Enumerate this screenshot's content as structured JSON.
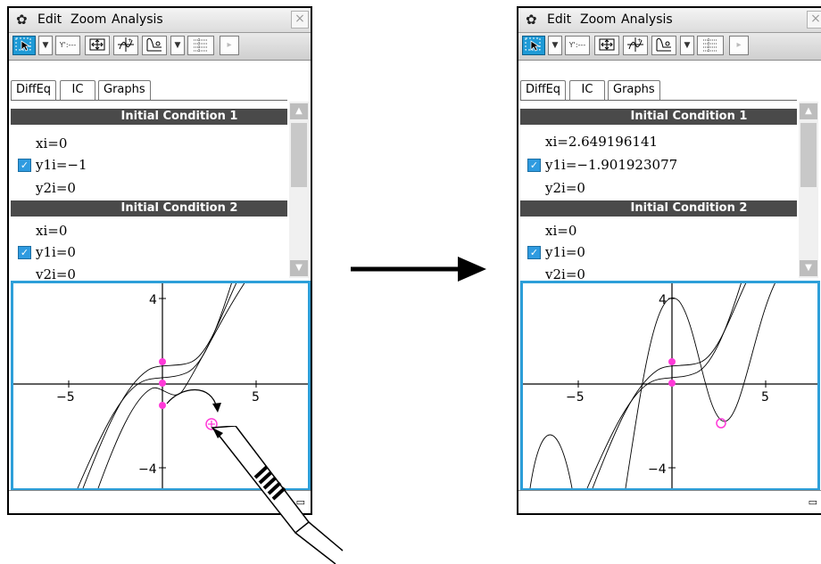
{
  "left": {
    "menu": [
      "Edit",
      "Zoom",
      "Analysis"
    ],
    "tabs": [
      "DiffEq",
      "IC",
      "Graphs"
    ],
    "ic1_header": "Initial Condition 1",
    "ic1_lines": [
      "xi=0",
      "y1i=−1",
      "y2i=0"
    ],
    "ic2_header": "Initial Condition 2",
    "ic2_lines": [
      "xi=0",
      "y1i=0",
      "y2i=0"
    ],
    "axis": {
      "y_top": "4",
      "y_bottom": "−4",
      "x_left": "−5",
      "x_right": "5"
    }
  },
  "right": {
    "menu": [
      "Edit",
      "Zoom",
      "Analysis"
    ],
    "tabs": [
      "DiffEq",
      "IC",
      "Graphs"
    ],
    "ic1_header": "Initial Condition 1",
    "ic1_lines": [
      "xi=2.649196141",
      "y1i=−1.901923077",
      "y2i=0"
    ],
    "ic2_header": "Initial Condition 2",
    "ic2_lines": [
      "xi=0",
      "y1i=0",
      "y2i=0"
    ],
    "axis": {
      "y_top": "4",
      "y_bottom": "−4",
      "x_left": "−5",
      "x_right": "5"
    }
  },
  "toolbar": {
    "y_button": "Y':---"
  },
  "icons": [
    "settings-icon",
    "select-arrow-icon",
    "zoom-box-icon",
    "sketch-icon",
    "table-icon",
    "close-icon",
    "battery-icon"
  ],
  "colors": {
    "selection": "#1e9ad6",
    "point": "#ff3ad8",
    "header": "#4a4a4a",
    "graph_border": "#2d9fd9"
  }
}
